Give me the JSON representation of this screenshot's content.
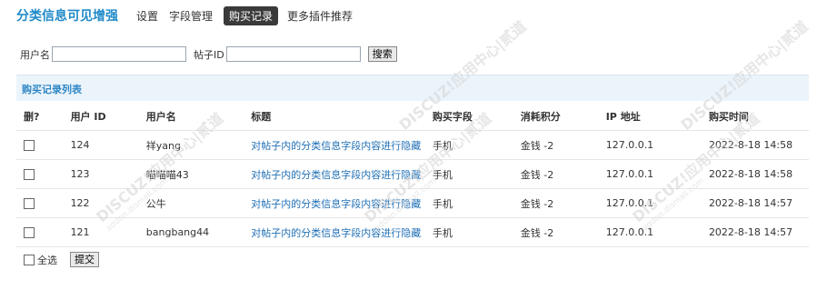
{
  "header": {
    "title": "分类信息可见增强",
    "nav": [
      {
        "label": "设置",
        "active": false
      },
      {
        "label": "字段管理",
        "active": false
      },
      {
        "label": "购买记录",
        "active": true
      },
      {
        "label": "更多插件推荐",
        "active": false
      }
    ]
  },
  "search": {
    "username_label": "用户名",
    "username_value": "",
    "thread_label": "帖子ID",
    "thread_value": "",
    "button": "搜索"
  },
  "section": {
    "title": "购买记录列表"
  },
  "table": {
    "columns": [
      "删?",
      "用户 ID",
      "用户名",
      "标题",
      "购买字段",
      "消耗积分",
      "IP 地址",
      "购买时间"
    ],
    "rows": [
      {
        "uid": "124",
        "username": "祥yang",
        "title": "对帖子内的分类信息字段内容进行隐藏",
        "field": "手机",
        "cost": "金钱 -2",
        "ip": "127.0.0.1",
        "time": "2022-8-18 14:58"
      },
      {
        "uid": "123",
        "username": "喵喵喵43",
        "title": "对帖子内的分类信息字段内容进行隐藏",
        "field": "手机",
        "cost": "金钱 -2",
        "ip": "127.0.0.1",
        "time": "2022-8-18 14:58"
      },
      {
        "uid": "122",
        "username": "公牛",
        "title": "对帖子内的分类信息字段内容进行隐藏",
        "field": "手机",
        "cost": "金钱 -2",
        "ip": "127.0.0.1",
        "time": "2022-8-18 14:57"
      },
      {
        "uid": "121",
        "username": "bangbang44",
        "title": "对帖子内的分类信息字段内容进行隐藏",
        "field": "手机",
        "cost": "金钱 -2",
        "ip": "127.0.0.1",
        "time": "2022-8-18 14:57"
      }
    ]
  },
  "footer": {
    "select_all_label": "全选",
    "submit": "提交"
  },
  "watermark": {
    "text": "DISCUZ!应用中心|贰道",
    "subtext": "addon.dismall.com"
  }
}
